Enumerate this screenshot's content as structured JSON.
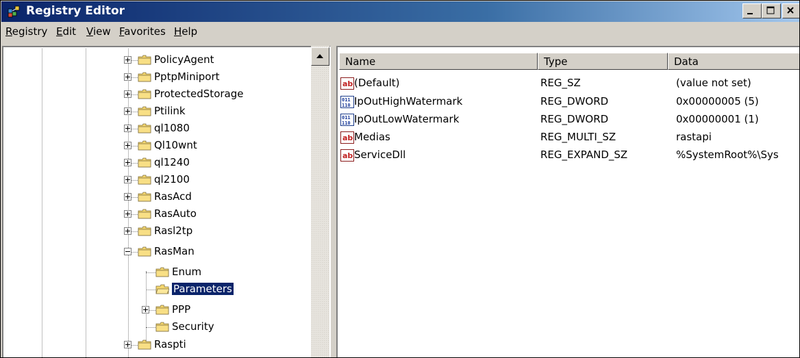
{
  "window": {
    "title": "Registry Editor"
  },
  "menu": [
    {
      "label": "Registry"
    },
    {
      "label": "Edit"
    },
    {
      "label": "View"
    },
    {
      "label": "Favorites"
    },
    {
      "label": "Help"
    }
  ],
  "tree": [
    {
      "label": "PolicyAgent"
    },
    {
      "label": "PptpMiniport"
    },
    {
      "label": "ProtectedStorage"
    },
    {
      "label": "Ptilink"
    },
    {
      "label": "ql1080"
    },
    {
      "label": "Ql10wnt"
    },
    {
      "label": "ql1240"
    },
    {
      "label": "ql2100"
    },
    {
      "label": "RasAcd"
    },
    {
      "label": "RasAuto"
    },
    {
      "label": "Rasl2tp"
    },
    {
      "label": "RasMan"
    },
    {
      "label": "Enum"
    },
    {
      "label": "Parameters"
    },
    {
      "label": "PPP"
    },
    {
      "label": "Security"
    },
    {
      "label": "Raspti"
    }
  ],
  "list": {
    "headers": {
      "name": "Name",
      "type": "Type",
      "data": "Data"
    },
    "rows": [
      {
        "name": "(Default)",
        "type": "REG_SZ",
        "data": "(value not set)",
        "icon": "string-value-icon"
      },
      {
        "name": "IpOutHighWatermark",
        "type": "REG_DWORD",
        "data": "0x00000005 (5)",
        "icon": "binary-value-icon"
      },
      {
        "name": "IpOutLowWatermark",
        "type": "REG_DWORD",
        "data": "0x00000001 (1)",
        "icon": "binary-value-icon"
      },
      {
        "name": "Medias",
        "type": "REG_MULTI_SZ",
        "data": "rastapi",
        "icon": "string-value-icon"
      },
      {
        "name": "ServiceDll",
        "type": "REG_EXPAND_SZ",
        "data": "%SystemRoot%\\Sys",
        "icon": "string-value-icon"
      }
    ]
  },
  "colors": {
    "title_active": "#0a246a",
    "face": "#d4d0c8",
    "selection": "#0a246a"
  }
}
